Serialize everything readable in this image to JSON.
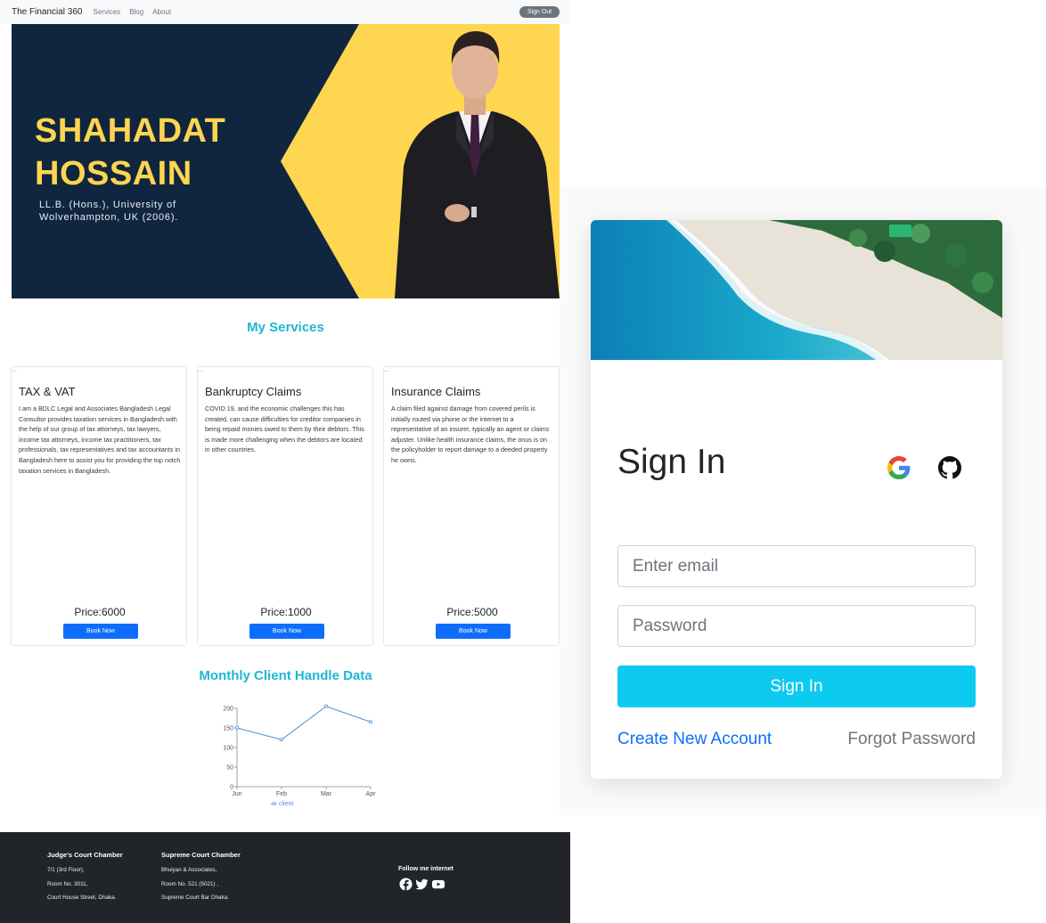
{
  "navbar": {
    "brand": "The Financial 360",
    "links": [
      "Services",
      "Blog",
      "About"
    ],
    "signout": "Sign Out"
  },
  "hero": {
    "name_line1": "SHAHADAT",
    "name_line2": "HOSSAIN",
    "sub_line1": "LL.B. (Hons.), University of",
    "sub_line2": "Wolverhampton, UK (2006)."
  },
  "services": {
    "title": "My Services",
    "broken_img_alt": "...",
    "cards": [
      {
        "title": "TAX & VAT",
        "text": "I am a BDLC Legal and Associates Bangladesh Legal Consultor provides taxation services in Bangladesh with the help of our group of tax attorneys, tax lawyers, income tax attorneys, income tax practitioners, tax professionals, tax representatives and tax accountants in Bangladesh here to assist you for providing the top notch taxation services in Bangladesh.",
        "price": "Price:6000",
        "button": "Book Now"
      },
      {
        "title": "Bankruptcy Claims",
        "text": "COVID 19, and the economic challenges this has created, can cause difficulties for creditor companies in being repaid monies owed to them by their debtors. This is made more challenging when the debtors are located in other countries.",
        "price": "Price:1000",
        "button": "Book Now"
      },
      {
        "title": "Insurance Claims",
        "text": "A claim filed against damage from covered perils is initially routed via phone or the internet to a representative of an insurer, typically an agent or claims adjuster. Unlike health insurance claims, the onus is on the policyholder to report damage to a deeded property he owns.",
        "price": "Price:5000",
        "button": "Book Now"
      }
    ]
  },
  "chart_section": {
    "title": "Monthly Client Handle Data"
  },
  "chart_data": {
    "type": "line",
    "categories": [
      "Jun",
      "Feb",
      "Mar",
      "Apr"
    ],
    "series": [
      {
        "name": "client",
        "values": [
          150,
          120,
          205,
          165
        ],
        "color": "#4a90d9"
      }
    ],
    "yticks": [
      0,
      50,
      100,
      150,
      200
    ],
    "ylim": [
      0,
      200
    ],
    "legend": "bottom"
  },
  "footer": {
    "col1": {
      "head": "Judge's Court Chamber",
      "lines": [
        "7/1 (3rd Floor),",
        "Room No. 3011,",
        "Court House Street, Dhaka."
      ]
    },
    "col2": {
      "head": "Supreme Court Chamber",
      "lines": [
        "Bhuiyan & Associates,",
        "Room No. 521 (5021) ,",
        "Supreme Court Bar Dhaka."
      ]
    },
    "follow": "Follow me internet",
    "icons": [
      "facebook-icon",
      "twitter-icon",
      "youtube-icon"
    ]
  },
  "signin": {
    "title": "Sign In",
    "email_placeholder": "Enter email",
    "password_placeholder": "Password",
    "submit": "Sign In",
    "create": "Create New Account",
    "forgot": "Forgot Password",
    "colors": {
      "submit": "#0dcaf0",
      "link": "#0d6efd"
    }
  }
}
